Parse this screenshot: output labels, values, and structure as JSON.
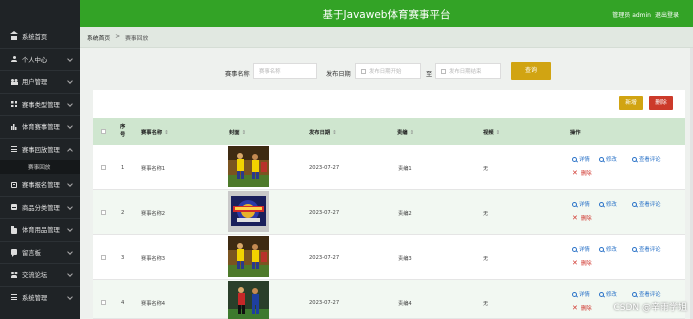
{
  "sidebar": {
    "items": [
      {
        "label": "系统首页",
        "icon": "home-icon"
      },
      {
        "label": "个人中心",
        "icon": "user-icon"
      },
      {
        "label": "用户管理",
        "icon": "users-icon"
      },
      {
        "label": "赛事类型管理",
        "icon": "grid-icon"
      },
      {
        "label": "体育赛事管理",
        "icon": "bar-chart-icon"
      },
      {
        "label": "赛事回放管理",
        "icon": "list-icon"
      },
      {
        "label": "赛事报名管理",
        "icon": "card-icon"
      },
      {
        "label": "商品分类管理",
        "icon": "box-icon"
      },
      {
        "label": "体育用品管理",
        "icon": "folder-icon"
      },
      {
        "label": "留言板",
        "icon": "chat-icon"
      },
      {
        "label": "交流论坛",
        "icon": "people-icon"
      },
      {
        "label": "系统管理",
        "icon": "list-icon"
      }
    ],
    "sub_item": "赛事回放"
  },
  "header": {
    "title": "基于Javaweb体育赛事平台",
    "user": "管理员 admin",
    "logout": "退出登录"
  },
  "breadcrumb": {
    "home": "系统首页",
    "separator": ">",
    "current": "赛事回放"
  },
  "search": {
    "name_label": "赛事名称",
    "name_placeholder": "赛事名称",
    "date_label": "发布日期",
    "date_start_placeholder": "发布日期开始",
    "date_range_sep": "至",
    "date_end_placeholder": "发布日期结束",
    "query_button": "查询"
  },
  "toolbar": {
    "add_label": "新增",
    "delete_label": "删除"
  },
  "table": {
    "headers": {
      "index": "序号",
      "name": "赛事名称",
      "cover": "封面",
      "date": "发布日期",
      "editor": "责编",
      "video": "视频",
      "actions": "操作"
    },
    "rows": [
      {
        "index": "1",
        "name": "赛事名称1",
        "date": "2023-07-27",
        "editor": "责编1",
        "video": "无"
      },
      {
        "index": "2",
        "name": "赛事名称2",
        "date": "2023-07-27",
        "editor": "责编2",
        "video": "无"
      },
      {
        "index": "3",
        "name": "赛事名称3",
        "date": "2023-07-27",
        "editor": "责编3",
        "video": "无"
      },
      {
        "index": "4",
        "name": "赛事名称4",
        "date": "2023-07-27",
        "editor": "责编4",
        "video": "无"
      }
    ],
    "actions": {
      "detail": "详情",
      "edit": "修改",
      "comments": "查看评论",
      "delete": "删除"
    }
  },
  "watermark": "CSDN @辛雨学姐",
  "colors": {
    "header": "#33a326",
    "sidebar": "#1f2326",
    "accent": "#d1a412",
    "danger": "#cc3a2a",
    "link": "#2b73c8"
  }
}
